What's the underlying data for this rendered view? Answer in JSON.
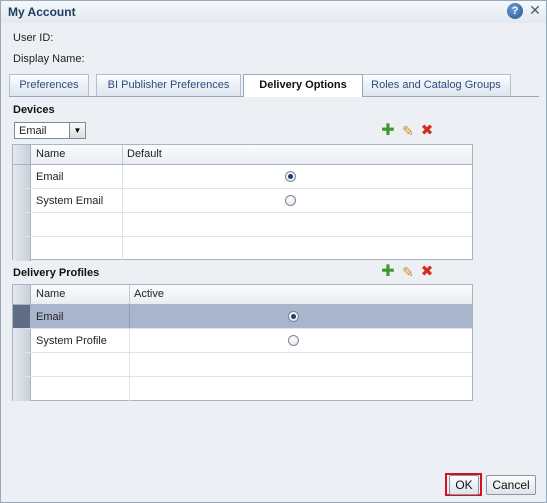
{
  "dialog": {
    "title": "My Account"
  },
  "fields": {
    "user_id_label": "User ID:",
    "display_name_label": "Display Name:"
  },
  "tabs": [
    {
      "label": "Preferences",
      "active": false
    },
    {
      "label": "BI Publisher Preferences",
      "active": false
    },
    {
      "label": "Delivery Options",
      "active": true
    },
    {
      "label": "Roles and Catalog Groups",
      "active": false
    }
  ],
  "devices": {
    "title": "Devices",
    "filter_value": "Email",
    "columns": [
      "Name",
      "Default"
    ],
    "rows": [
      {
        "name": "Email",
        "default": true
      },
      {
        "name": "System Email",
        "default": false
      }
    ]
  },
  "profiles": {
    "title": "Delivery Profiles",
    "columns": [
      "Name",
      "Active"
    ],
    "rows": [
      {
        "name": "Email",
        "active": true,
        "selected": true
      },
      {
        "name": "System Profile",
        "active": false,
        "selected": false
      }
    ]
  },
  "icons": {
    "help": "help-icon",
    "close": "close-icon",
    "add": "add-icon",
    "edit": "edit-icon",
    "delete": "delete-icon"
  },
  "buttons": {
    "ok": "OK",
    "cancel": "Cancel"
  },
  "colors": {
    "title": "#1c3b5e",
    "selected_row": "#a8b5cd",
    "add": "#3a9a2b",
    "delete": "#d22c1c",
    "highlight": "#d4121f"
  }
}
